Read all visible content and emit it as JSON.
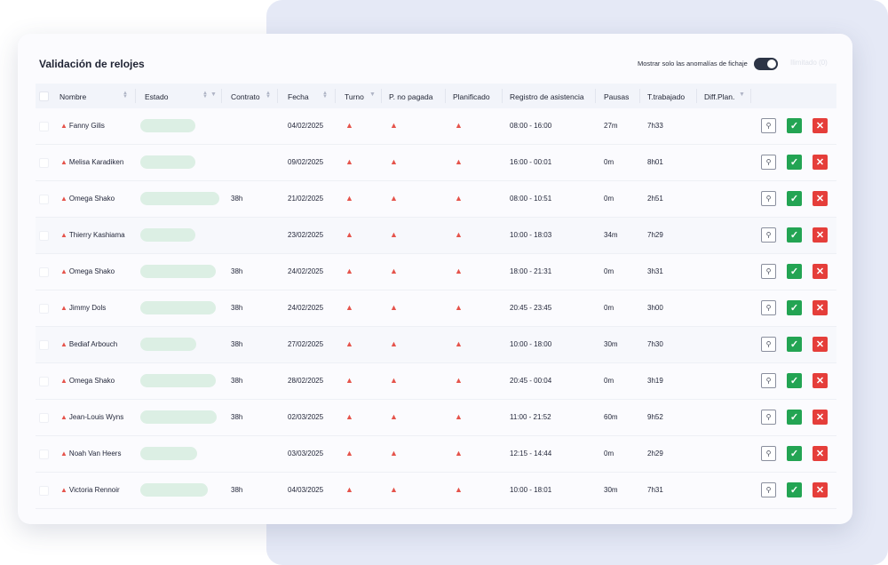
{
  "title": "Validación de relojes",
  "toggle": {
    "label": "Mostrar solo las anomalías de fichaje",
    "on": true
  },
  "faint_text": "Ilimitado (0)",
  "columns": {
    "nombre": "Nombre",
    "estado": "Estado",
    "contrato": "Contrato",
    "fecha": "Fecha",
    "turno": "Turno",
    "pnopagada": "P. no pagada",
    "planificado": "Planificado",
    "registro": "Registro de asistencia",
    "pausas": "Pausas",
    "trabajado": "T.trabajado",
    "diff": "Diff.Plan."
  },
  "icons": {
    "warning": "warning-icon",
    "pin": "pin-icon",
    "approve": "check-icon",
    "reject": "close-icon"
  },
  "colors": {
    "approve": "#23a453",
    "reject": "#e53e3a",
    "warning": "#e5534b",
    "status_pill": "#dcefe4"
  },
  "rows": [
    {
      "name": "Fanny Gilis",
      "contrato": "",
      "fecha": "04/02/2025",
      "registro": "08:00 - 16:00",
      "pausas": "27m",
      "trabajado": "7h33"
    },
    {
      "name": "Melisa Karadiken",
      "contrato": "",
      "fecha": "09/02/2025",
      "registro": "16:00 - 00:01",
      "pausas": "0m",
      "trabajado": "8h01"
    },
    {
      "name": "Omega Shako",
      "contrato": "38h",
      "fecha": "21/02/2025",
      "registro": "08:00 - 10:51",
      "pausas": "0m",
      "trabajado": "2h51"
    },
    {
      "name": "Thierry Kashiama",
      "contrato": "",
      "fecha": "23/02/2025",
      "registro": "10:00 - 18:03",
      "pausas": "34m",
      "trabajado": "7h29"
    },
    {
      "name": "Omega Shako",
      "contrato": "38h",
      "fecha": "24/02/2025",
      "registro": "18:00 - 21:31",
      "pausas": "0m",
      "trabajado": "3h31"
    },
    {
      "name": "Jimmy Dols",
      "contrato": "38h",
      "fecha": "24/02/2025",
      "registro": "20:45 - 23:45",
      "pausas": "0m",
      "trabajado": "3h00"
    },
    {
      "name": "Bediaf Arbouch",
      "contrato": "38h",
      "fecha": "27/02/2025",
      "registro": "10:00 - 18:00",
      "pausas": "30m",
      "trabajado": "7h30"
    },
    {
      "name": "Omega Shako",
      "contrato": "38h",
      "fecha": "28/02/2025",
      "registro": "20:45 - 00:04",
      "pausas": "0m",
      "trabajado": "3h19"
    },
    {
      "name": "Jean-Louis Wyns",
      "contrato": "38h",
      "fecha": "02/03/2025",
      "registro": "11:00 - 21:52",
      "pausas": "60m",
      "trabajado": "9h52"
    },
    {
      "name": "Noah Van Heers",
      "contrato": "",
      "fecha": "03/03/2025",
      "registro": "12:15 - 14:44",
      "pausas": "0m",
      "trabajado": "2h29"
    },
    {
      "name": "Victoria Rennoir",
      "contrato": "38h",
      "fecha": "04/03/2025",
      "registro": "10:00 - 18:01",
      "pausas": "30m",
      "trabajado": "7h31"
    }
  ]
}
